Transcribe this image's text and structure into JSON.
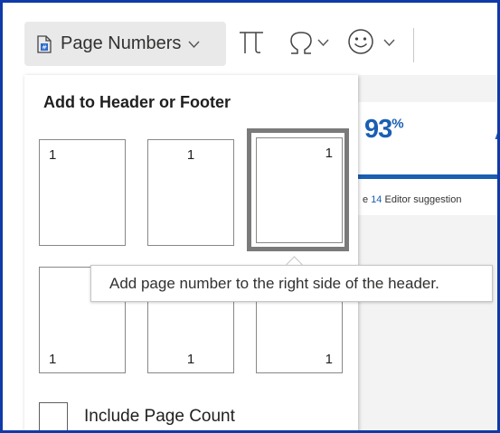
{
  "ribbon": {
    "page_numbers_label": "Page Numbers",
    "icons": [
      "page-number-icon",
      "equation-icon",
      "symbol-omega-icon",
      "emoji-icon"
    ]
  },
  "background_doc": {
    "score": "93",
    "score_unit": "%",
    "score_cut_letter": "A",
    "suggestion_prefix": "e ",
    "suggestion_count": "14",
    "suggestion_suffix": " Editor suggestion"
  },
  "menu": {
    "heading": "Add to Header or Footer",
    "options": [
      {
        "position": "header-left",
        "number": "1"
      },
      {
        "position": "header-center",
        "number": "1"
      },
      {
        "position": "header-right",
        "number": "1",
        "selected": true
      },
      {
        "position": "footer-left",
        "number": "1"
      },
      {
        "position": "footer-center",
        "number": "1"
      },
      {
        "position": "footer-right",
        "number": "1"
      }
    ],
    "include_page_count_label": "Include Page Count",
    "include_page_count_checked": false
  },
  "tooltip": {
    "text": "Add page number to the right side of the header."
  },
  "colors": {
    "frame_border": "#0f3aa8",
    "accent_blue": "#1a5fb4",
    "button_bg": "#e9e9e9",
    "selected_ring": "#7a7a7a"
  }
}
